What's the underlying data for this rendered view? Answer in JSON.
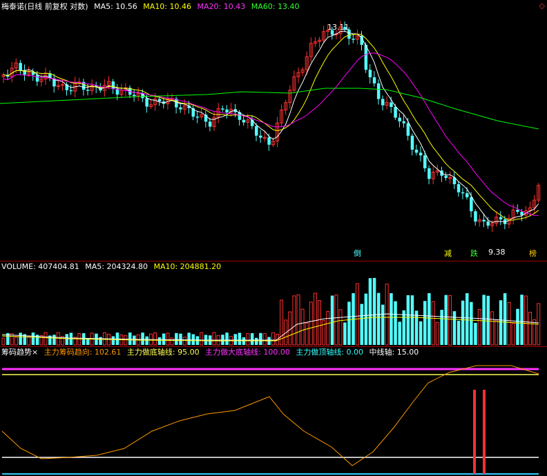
{
  "price_header": {
    "title": "梅泰诺(日线 前复权 对数)",
    "ma5": "MA5: 10.56",
    "ma10": "MA10: 10.46",
    "ma20": "MA20: 10.43",
    "ma60": "MA60: 13.40"
  },
  "volume_header": {
    "title": "VOLUME: 407404.81",
    "ma5": "MA5: 204324.80",
    "ma10": "MA10: 204881.20"
  },
  "chip_header": {
    "title": "筹码趋势×",
    "direction": "主力筹码趋向: 102.61",
    "bottom_axis": "主力做底轴线: 95.00",
    "big_bottom_axis": "主力做大底轴线: 100.00",
    "top_axis": "主力做顶轴线: 0.00",
    "mid_axis": "中线轴: 15.00"
  },
  "price_labels": {
    "high": "13.11",
    "low": "9.38",
    "tag_a": "倒",
    "tag_b": "减",
    "tag_c": "跌",
    "tag_d": "榜"
  },
  "colors": {
    "up": "#ff3030",
    "down": "#54ffff",
    "ma5": "#ffffff",
    "ma10": "#ffff00",
    "ma20": "#ff00ff",
    "ma60": "#00ff00",
    "trend": "#ff9900",
    "axis_big_bottom": "#ff33ff",
    "axis_bottom": "#ffff55"
  },
  "chart_data": [
    {
      "type": "candlestick",
      "series": [
        {
          "name": "MA5",
          "value": 10.56
        },
        {
          "name": "MA10",
          "value": 10.46
        },
        {
          "name": "MA20",
          "value": 10.43
        },
        {
          "name": "MA60",
          "value": 13.4
        }
      ],
      "high_label": 13.11,
      "low_label": 9.38,
      "y_scale": "log"
    },
    {
      "type": "bar",
      "series": [
        {
          "name": "VOLUME",
          "value": 407404.81
        },
        {
          "name": "MA5",
          "value": 204324.8
        },
        {
          "name": "MA10",
          "value": 204881.2
        }
      ]
    },
    {
      "type": "line",
      "series": [
        {
          "name": "主力筹码趋向",
          "value": 102.61
        },
        {
          "name": "主力做底轴线",
          "value": 95.0
        },
        {
          "name": "主力做大底轴线",
          "value": 100.0
        },
        {
          "name": "主力做顶轴线",
          "value": 0.0
        },
        {
          "name": "中线轴",
          "value": 15.0
        }
      ]
    }
  ]
}
